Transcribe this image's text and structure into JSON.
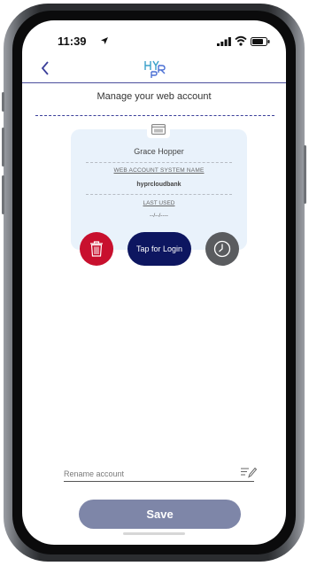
{
  "status_bar": {
    "time": "11:39",
    "icons": [
      "location-arrow-icon",
      "signal-icon",
      "wifi-icon",
      "battery-icon"
    ]
  },
  "header": {
    "back_icon": "chevron-left-icon",
    "logo_icon": "hypr-logo-icon",
    "accent_color": "#4b4f9d"
  },
  "page": {
    "title": "Manage your web account"
  },
  "account_card": {
    "icon": "browser-window-icon",
    "user_name": "Grace Hopper",
    "system_name_label": "WEB ACCOUNT SYSTEM NAME",
    "system_name_value": "hyprcloudbank",
    "last_used_label": "LAST USED",
    "last_used_value": "--/--/----"
  },
  "actions": {
    "delete_icon": "trash-icon",
    "delete_color": "#c8102e",
    "login_label": "Tap for Login",
    "login_color": "#0d1660",
    "history_icon": "clock-icon",
    "history_color": "#5a5c5f"
  },
  "rename": {
    "placeholder": "Rename account",
    "value": "",
    "icon": "edit-pencil-icon"
  },
  "footer": {
    "save_label": "Save",
    "save_color": "#7e86a8"
  }
}
